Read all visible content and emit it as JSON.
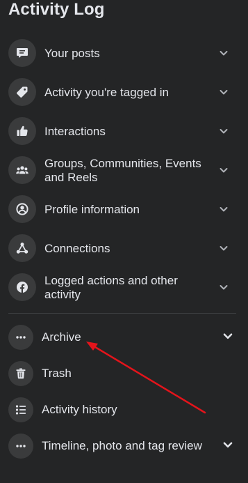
{
  "header": {
    "title": "Activity Log"
  },
  "menu": {
    "items": [
      {
        "label": "Your posts",
        "icon": "speech-bubble-icon"
      },
      {
        "label": "Activity you're tagged in",
        "icon": "tag-icon"
      },
      {
        "label": "Interactions",
        "icon": "thumbs-up-icon"
      },
      {
        "label": "Groups, Communities, Events and Reels",
        "icon": "people-group-icon"
      },
      {
        "label": "Profile information",
        "icon": "user-circle-icon"
      },
      {
        "label": "Connections",
        "icon": "connections-icon"
      },
      {
        "label": "Logged actions and other activity",
        "icon": "facebook-icon"
      }
    ]
  },
  "secondary": {
    "items": [
      {
        "label": "Archive",
        "icon": "more-dots-icon"
      },
      {
        "label": "Trash",
        "icon": "trash-icon"
      },
      {
        "label": "Activity history",
        "icon": "list-icon"
      },
      {
        "label": "Timeline, photo and tag review",
        "icon": "more-dots-icon"
      }
    ]
  },
  "annotation": {
    "arrow_color": "#e4141b",
    "points_to": "Archive"
  }
}
